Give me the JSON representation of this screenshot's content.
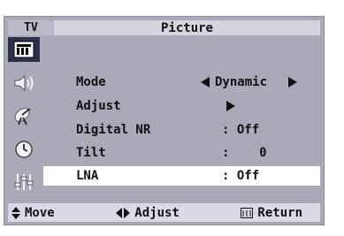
{
  "header": {
    "tab": "TV",
    "title": "Picture"
  },
  "sidebar": {
    "icons": [
      {
        "name": "picture-icon",
        "active": true
      },
      {
        "name": "sound-icon",
        "active": false
      },
      {
        "name": "antenna-icon",
        "active": false
      },
      {
        "name": "clock-icon",
        "active": false
      },
      {
        "name": "setup-icon",
        "active": false
      }
    ]
  },
  "menu": {
    "items": [
      {
        "label": "Mode",
        "value": "Dynamic",
        "type": "select"
      },
      {
        "label": "Adjust",
        "value": "",
        "type": "submenu"
      },
      {
        "label": "Digital NR",
        "value": ": Off",
        "type": "value"
      },
      {
        "label": "Tilt",
        "value": ":    0",
        "type": "value"
      },
      {
        "label": "LNA",
        "value": ": Off",
        "type": "value",
        "selected": true
      }
    ]
  },
  "footer": {
    "move": "Move",
    "adjust": "Adjust",
    "return": "Return"
  }
}
